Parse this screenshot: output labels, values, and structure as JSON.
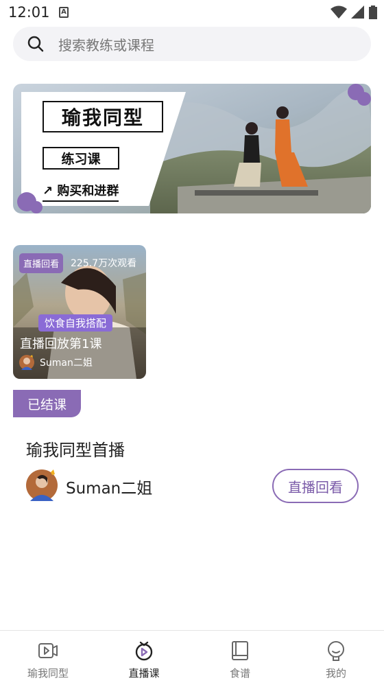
{
  "status_bar": {
    "time": "12:01",
    "notification_letter": "A"
  },
  "search": {
    "placeholder": "搜索教练或课程"
  },
  "banner": {
    "title": "瑜我同型",
    "subtitle": "练习课",
    "cta": "↗ 购买和进群"
  },
  "course_card": {
    "tag": "直播回看",
    "views": "225.7万次观看",
    "highlight": "饮食自我搭配",
    "title": "直播回放第1课",
    "author": "Suman二姐"
  },
  "live_session": {
    "status_badge": "已结课",
    "title": "瑜我同型首播",
    "host_name": "Suman二姐",
    "replay_button": "直播回看"
  },
  "bottom_nav": {
    "items": [
      {
        "label": "瑜我同型",
        "icon": "video-icon"
      },
      {
        "label": "直播课",
        "icon": "live-icon",
        "active": true
      },
      {
        "label": "食谱",
        "icon": "book-icon"
      },
      {
        "label": "我的",
        "icon": "profile-icon"
      }
    ]
  },
  "colors": {
    "accent": "#8a6bb5",
    "highlight": "#8a6bd6"
  }
}
